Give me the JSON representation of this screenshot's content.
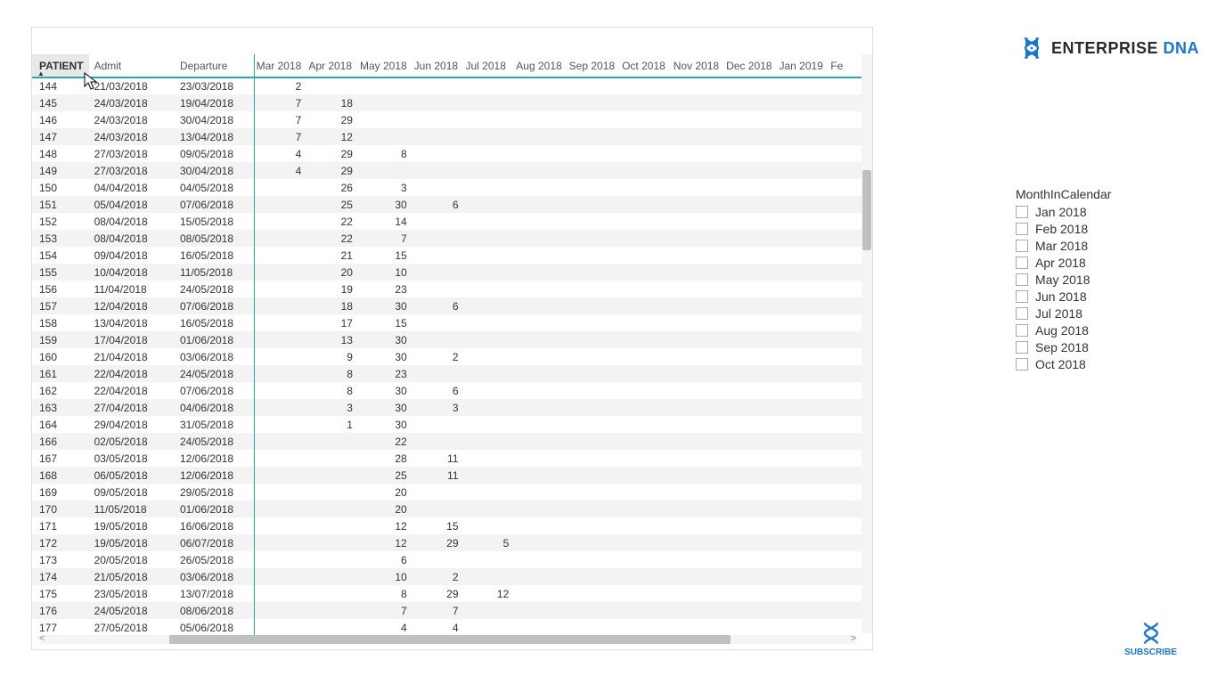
{
  "logo": {
    "text1": "ENTERPRISE ",
    "text2": "DNA"
  },
  "subscribe": {
    "label": "SUBSCRIBE"
  },
  "slicer": {
    "title": "MonthInCalendar",
    "items": [
      "Jan 2018",
      "Feb 2018",
      "Mar 2018",
      "Apr 2018",
      "May 2018",
      "Jun 2018",
      "Jul 2018",
      "Aug 2018",
      "Sep 2018",
      "Oct 2018"
    ]
  },
  "chart_data": {
    "type": "table",
    "columns": [
      "PATIENT",
      "Admit",
      "Departure",
      "Mar 2018",
      "Apr 2018",
      "May 2018",
      "Jun 2018",
      "Jul 2018",
      "Aug 2018",
      "Sep 2018",
      "Oct 2018",
      "Nov 2018",
      "Dec 2018",
      "Jan 2019",
      "Fe"
    ],
    "rows": [
      {
        "patient": "144",
        "admit": "21/03/2018",
        "dep": "23/03/2018",
        "m": [
          "2",
          "",
          "",
          "",
          "",
          "",
          "",
          "",
          "",
          "",
          "",
          ""
        ]
      },
      {
        "patient": "145",
        "admit": "24/03/2018",
        "dep": "19/04/2018",
        "m": [
          "7",
          "18",
          "",
          "",
          "",
          "",
          "",
          "",
          "",
          "",
          "",
          ""
        ]
      },
      {
        "patient": "146",
        "admit": "24/03/2018",
        "dep": "30/04/2018",
        "m": [
          "7",
          "29",
          "",
          "",
          "",
          "",
          "",
          "",
          "",
          "",
          "",
          ""
        ]
      },
      {
        "patient": "147",
        "admit": "24/03/2018",
        "dep": "13/04/2018",
        "m": [
          "7",
          "12",
          "",
          "",
          "",
          "",
          "",
          "",
          "",
          "",
          "",
          ""
        ]
      },
      {
        "patient": "148",
        "admit": "27/03/2018",
        "dep": "09/05/2018",
        "m": [
          "4",
          "29",
          "8",
          "",
          "",
          "",
          "",
          "",
          "",
          "",
          "",
          ""
        ]
      },
      {
        "patient": "149",
        "admit": "27/03/2018",
        "dep": "30/04/2018",
        "m": [
          "4",
          "29",
          "",
          "",
          "",
          "",
          "",
          "",
          "",
          "",
          "",
          ""
        ]
      },
      {
        "patient": "150",
        "admit": "04/04/2018",
        "dep": "04/05/2018",
        "m": [
          "",
          "26",
          "3",
          "",
          "",
          "",
          "",
          "",
          "",
          "",
          "",
          ""
        ]
      },
      {
        "patient": "151",
        "admit": "05/04/2018",
        "dep": "07/06/2018",
        "m": [
          "",
          "25",
          "30",
          "6",
          "",
          "",
          "",
          "",
          "",
          "",
          "",
          ""
        ]
      },
      {
        "patient": "152",
        "admit": "08/04/2018",
        "dep": "15/05/2018",
        "m": [
          "",
          "22",
          "14",
          "",
          "",
          "",
          "",
          "",
          "",
          "",
          "",
          ""
        ]
      },
      {
        "patient": "153",
        "admit": "08/04/2018",
        "dep": "08/05/2018",
        "m": [
          "",
          "22",
          "7",
          "",
          "",
          "",
          "",
          "",
          "",
          "",
          "",
          ""
        ]
      },
      {
        "patient": "154",
        "admit": "09/04/2018",
        "dep": "16/05/2018",
        "m": [
          "",
          "21",
          "15",
          "",
          "",
          "",
          "",
          "",
          "",
          "",
          "",
          ""
        ]
      },
      {
        "patient": "155",
        "admit": "10/04/2018",
        "dep": "11/05/2018",
        "m": [
          "",
          "20",
          "10",
          "",
          "",
          "",
          "",
          "",
          "",
          "",
          "",
          ""
        ]
      },
      {
        "patient": "156",
        "admit": "11/04/2018",
        "dep": "24/05/2018",
        "m": [
          "",
          "19",
          "23",
          "",
          "",
          "",
          "",
          "",
          "",
          "",
          "",
          ""
        ]
      },
      {
        "patient": "157",
        "admit": "12/04/2018",
        "dep": "07/06/2018",
        "m": [
          "",
          "18",
          "30",
          "6",
          "",
          "",
          "",
          "",
          "",
          "",
          "",
          ""
        ]
      },
      {
        "patient": "158",
        "admit": "13/04/2018",
        "dep": "16/05/2018",
        "m": [
          "",
          "17",
          "15",
          "",
          "",
          "",
          "",
          "",
          "",
          "",
          "",
          ""
        ]
      },
      {
        "patient": "159",
        "admit": "17/04/2018",
        "dep": "01/06/2018",
        "m": [
          "",
          "13",
          "30",
          "",
          "",
          "",
          "",
          "",
          "",
          "",
          "",
          ""
        ]
      },
      {
        "patient": "160",
        "admit": "21/04/2018",
        "dep": "03/06/2018",
        "m": [
          "",
          "9",
          "30",
          "2",
          "",
          "",
          "",
          "",
          "",
          "",
          "",
          ""
        ]
      },
      {
        "patient": "161",
        "admit": "22/04/2018",
        "dep": "24/05/2018",
        "m": [
          "",
          "8",
          "23",
          "",
          "",
          "",
          "",
          "",
          "",
          "",
          "",
          ""
        ]
      },
      {
        "patient": "162",
        "admit": "22/04/2018",
        "dep": "07/06/2018",
        "m": [
          "",
          "8",
          "30",
          "6",
          "",
          "",
          "",
          "",
          "",
          "",
          "",
          ""
        ]
      },
      {
        "patient": "163",
        "admit": "27/04/2018",
        "dep": "04/06/2018",
        "m": [
          "",
          "3",
          "30",
          "3",
          "",
          "",
          "",
          "",
          "",
          "",
          "",
          ""
        ]
      },
      {
        "patient": "164",
        "admit": "29/04/2018",
        "dep": "31/05/2018",
        "m": [
          "",
          "1",
          "30",
          "",
          "",
          "",
          "",
          "",
          "",
          "",
          "",
          ""
        ]
      },
      {
        "patient": "166",
        "admit": "02/05/2018",
        "dep": "24/05/2018",
        "m": [
          "",
          "",
          "22",
          "",
          "",
          "",
          "",
          "",
          "",
          "",
          "",
          ""
        ]
      },
      {
        "patient": "167",
        "admit": "03/05/2018",
        "dep": "12/06/2018",
        "m": [
          "",
          "",
          "28",
          "11",
          "",
          "",
          "",
          "",
          "",
          "",
          "",
          ""
        ]
      },
      {
        "patient": "168",
        "admit": "06/05/2018",
        "dep": "12/06/2018",
        "m": [
          "",
          "",
          "25",
          "11",
          "",
          "",
          "",
          "",
          "",
          "",
          "",
          ""
        ]
      },
      {
        "patient": "169",
        "admit": "09/05/2018",
        "dep": "29/05/2018",
        "m": [
          "",
          "",
          "20",
          "",
          "",
          "",
          "",
          "",
          "",
          "",
          "",
          ""
        ]
      },
      {
        "patient": "170",
        "admit": "11/05/2018",
        "dep": "01/06/2018",
        "m": [
          "",
          "",
          "20",
          "",
          "",
          "",
          "",
          "",
          "",
          "",
          "",
          ""
        ]
      },
      {
        "patient": "171",
        "admit": "19/05/2018",
        "dep": "16/06/2018",
        "m": [
          "",
          "",
          "12",
          "15",
          "",
          "",
          "",
          "",
          "",
          "",
          "",
          ""
        ]
      },
      {
        "patient": "172",
        "admit": "19/05/2018",
        "dep": "06/07/2018",
        "m": [
          "",
          "",
          "12",
          "29",
          "5",
          "",
          "",
          "",
          "",
          "",
          "",
          ""
        ]
      },
      {
        "patient": "173",
        "admit": "20/05/2018",
        "dep": "26/05/2018",
        "m": [
          "",
          "",
          "6",
          "",
          "",
          "",
          "",
          "",
          "",
          "",
          "",
          ""
        ]
      },
      {
        "patient": "174",
        "admit": "21/05/2018",
        "dep": "03/06/2018",
        "m": [
          "",
          "",
          "10",
          "2",
          "",
          "",
          "",
          "",
          "",
          "",
          "",
          ""
        ]
      },
      {
        "patient": "175",
        "admit": "23/05/2018",
        "dep": "13/07/2018",
        "m": [
          "",
          "",
          "8",
          "29",
          "12",
          "",
          "",
          "",
          "",
          "",
          "",
          ""
        ]
      },
      {
        "patient": "176",
        "admit": "24/05/2018",
        "dep": "08/06/2018",
        "m": [
          "",
          "",
          "7",
          "7",
          "",
          "",
          "",
          "",
          "",
          "",
          "",
          ""
        ]
      },
      {
        "patient": "177",
        "admit": "27/05/2018",
        "dep": "05/06/2018",
        "m": [
          "",
          "",
          "4",
          "4",
          "",
          "",
          "",
          "",
          "",
          "",
          "",
          ""
        ]
      }
    ]
  }
}
